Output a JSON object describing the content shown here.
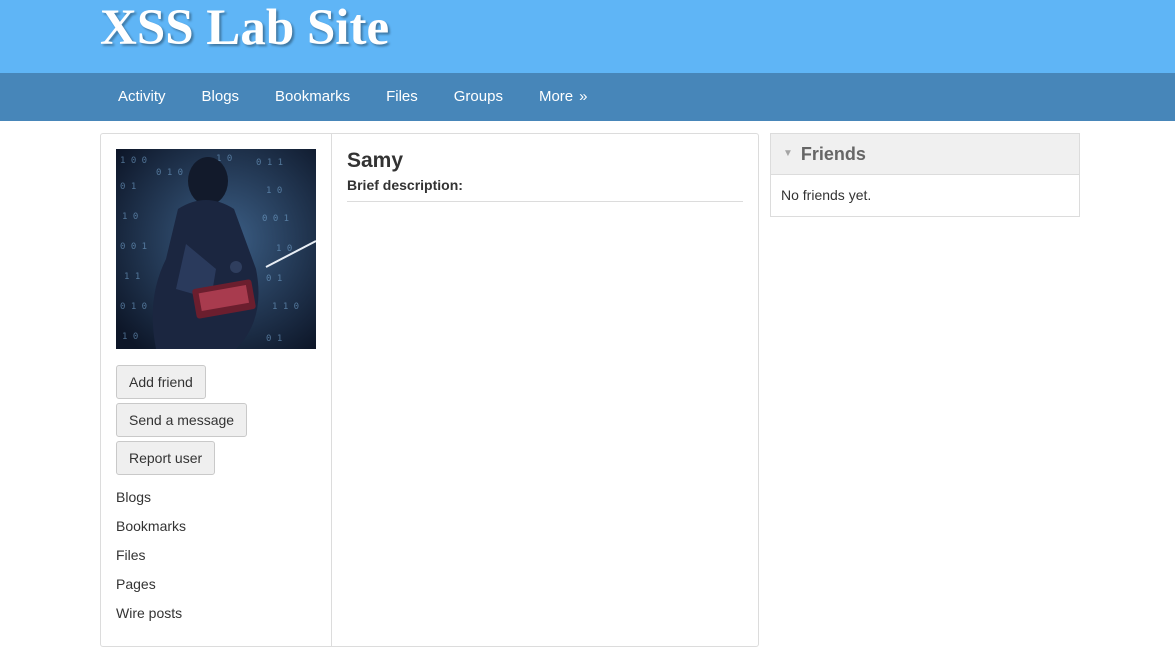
{
  "site": {
    "title": "XSS Lab Site"
  },
  "nav": {
    "items": [
      {
        "label": "Activity"
      },
      {
        "label": "Blogs"
      },
      {
        "label": "Bookmarks"
      },
      {
        "label": "Files"
      },
      {
        "label": "Groups"
      }
    ],
    "more_label": "More",
    "more_arrow": "»"
  },
  "profile": {
    "name": "Samy",
    "brief_description_label": "Brief description:",
    "buttons": {
      "add_friend": "Add friend",
      "send_message": "Send a message",
      "report_user": "Report user"
    },
    "links": [
      {
        "label": "Blogs"
      },
      {
        "label": "Bookmarks"
      },
      {
        "label": "Files"
      },
      {
        "label": "Pages"
      },
      {
        "label": "Wire posts"
      }
    ]
  },
  "friends": {
    "title": "Friends",
    "toggle_glyph": "▼",
    "empty_message": "No friends yet."
  },
  "colors": {
    "header_bg": "#5fb5f6",
    "nav_bg": "#4786b9",
    "button_bg": "#efefef",
    "module_header_bg": "#f0f0f0",
    "border": "#dcdcdc"
  },
  "icons": {
    "toggle": "triangle-down-icon",
    "more": "double-chevron-right-icon"
  }
}
